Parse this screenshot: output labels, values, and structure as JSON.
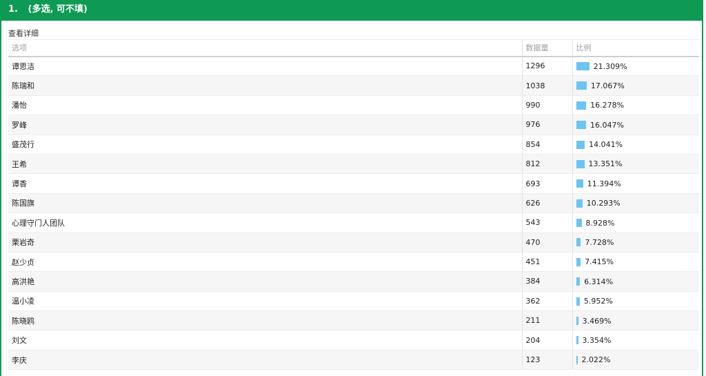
{
  "question": {
    "number": "1.",
    "title": "(多选, 可不填)"
  },
  "detail_link": "查看详细",
  "table": {
    "headers": [
      "选项",
      "数据量",
      "比例"
    ],
    "rows": [
      {
        "option": "谭思洁",
        "count": "1296",
        "pct": "21.309%",
        "value": 21.309
      },
      {
        "option": "陈瑞和",
        "count": "1038",
        "pct": "17.067%",
        "value": 17.067
      },
      {
        "option": "潘怡",
        "count": "990",
        "pct": "16.278%",
        "value": 16.278
      },
      {
        "option": "罗峰",
        "count": "976",
        "pct": "16.047%",
        "value": 16.047
      },
      {
        "option": "盛茂行",
        "count": "854",
        "pct": "14.041%",
        "value": 14.041
      },
      {
        "option": "王希",
        "count": "812",
        "pct": "13.351%",
        "value": 13.351
      },
      {
        "option": "谭香",
        "count": "693",
        "pct": "11.394%",
        "value": 11.394
      },
      {
        "option": "陈国旗",
        "count": "626",
        "pct": "10.293%",
        "value": 10.293
      },
      {
        "option": "心理守门人团队",
        "count": "543",
        "pct": "8.928%",
        "value": 8.928
      },
      {
        "option": "栗岩奇",
        "count": "470",
        "pct": "7.728%",
        "value": 7.728
      },
      {
        "option": "赵少贞",
        "count": "451",
        "pct": "7.415%",
        "value": 7.415
      },
      {
        "option": "高洪艳",
        "count": "384",
        "pct": "6.314%",
        "value": 6.314
      },
      {
        "option": "温小凌",
        "count": "362",
        "pct": "5.952%",
        "value": 5.952
      },
      {
        "option": "陈晓鸥",
        "count": "211",
        "pct": "3.469%",
        "value": 3.469
      },
      {
        "option": "刘文",
        "count": "204",
        "pct": "3.354%",
        "value": 3.354
      },
      {
        "option": "李庆",
        "count": "123",
        "pct": "2.022%",
        "value": 2.022
      }
    ]
  },
  "colors": {
    "header_bg": "#0e9a55",
    "bar": "#6cc4f2"
  }
}
